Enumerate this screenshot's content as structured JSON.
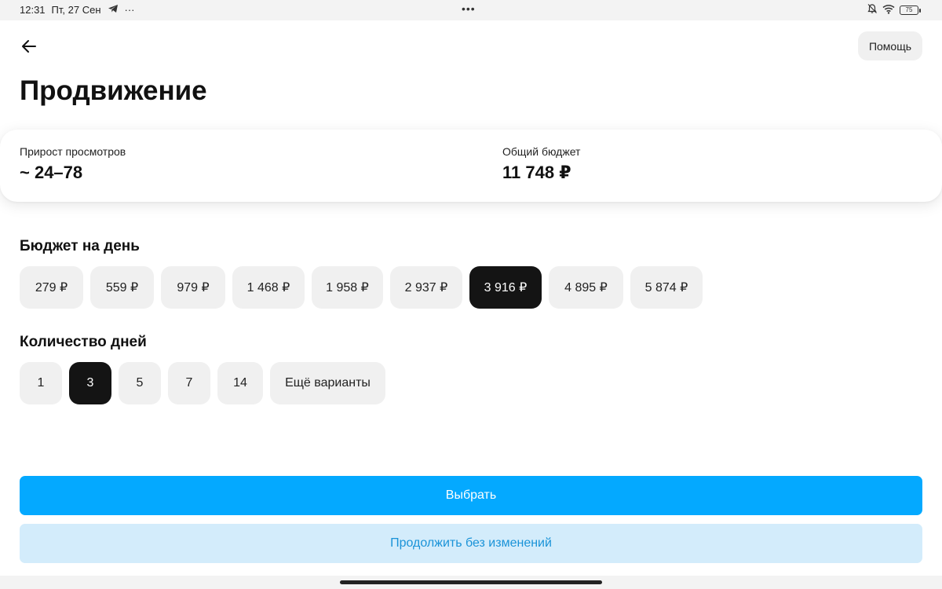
{
  "status_bar": {
    "time": "12:31",
    "date": "Пт, 27 Сен",
    "more_dots": "···",
    "center_dots": "•••",
    "battery_level": "75"
  },
  "header": {
    "back_icon": "arrow-left-icon",
    "help_label": "Помощь"
  },
  "page": {
    "title": "Продвижение"
  },
  "stats": {
    "views_label": "Прирост просмотров",
    "views_value": "~ 24–78",
    "budget_label": "Общий бюджет",
    "budget_value": "11 748 ₽"
  },
  "daily_budget": {
    "title": "Бюджет на день",
    "options": [
      "279 ₽",
      "559 ₽",
      "979 ₽",
      "1 468 ₽",
      "1 958 ₽",
      "2 937 ₽",
      "3 916 ₽",
      "4 895 ₽",
      "5 874 ₽"
    ],
    "selected": "3 916 ₽"
  },
  "days": {
    "title": "Количество дней",
    "options": [
      "1",
      "3",
      "5",
      "7",
      "14",
      "Ещё варианты"
    ],
    "selected": "3"
  },
  "actions": {
    "primary_label": "Выбрать",
    "secondary_label": "Продолжить без изменений"
  },
  "colors": {
    "primary": "#04a9ff",
    "secondary_bg": "#d3ecfb",
    "secondary_text": "#1a93d8",
    "chip_bg": "#f0f0f0",
    "chip_selected_bg": "#141414"
  }
}
